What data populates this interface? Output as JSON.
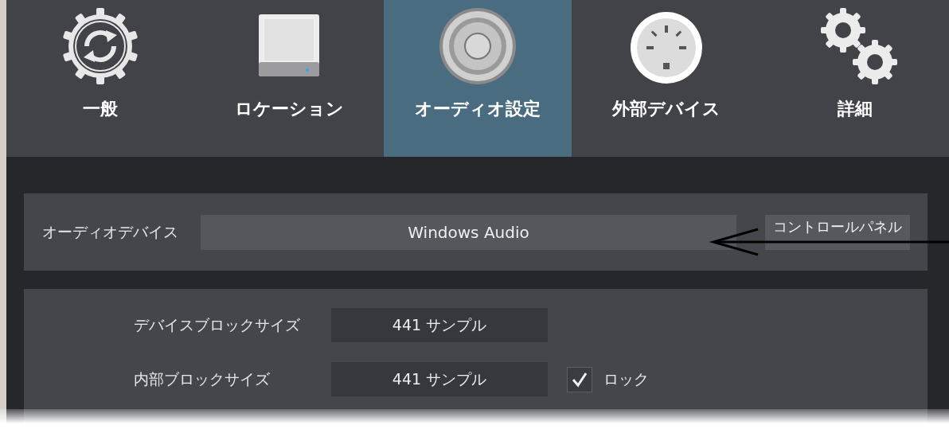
{
  "tabs": [
    {
      "label": "一般",
      "kind": "general",
      "selected": false
    },
    {
      "label": "ロケーション",
      "kind": "location",
      "selected": false
    },
    {
      "label": "オーディオ設定",
      "kind": "audio",
      "selected": true
    },
    {
      "label": "外部デバイス",
      "kind": "external",
      "selected": false
    },
    {
      "label": "詳細",
      "kind": "advanced",
      "selected": false
    }
  ],
  "device_row": {
    "label": "オーディオデバイス",
    "value": "Windows Audio",
    "button": "コントロールパネル"
  },
  "block_rows": [
    {
      "label": "デバイスブロックサイズ",
      "value": "441 サンプル"
    },
    {
      "label": "内部ブロックサイズ",
      "value": "441 サンプル",
      "lock": {
        "label": "ロック",
        "checked": true
      }
    }
  ]
}
